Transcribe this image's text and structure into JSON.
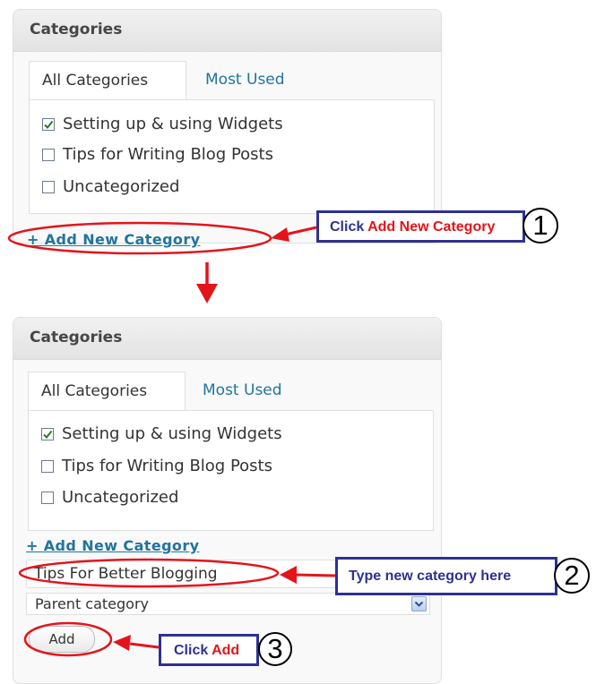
{
  "panel1": {
    "title": "Categories",
    "tabs": [
      {
        "label": "All Categories"
      },
      {
        "label": "Most Used"
      }
    ],
    "categories": [
      {
        "label": "Setting up & using Widgets",
        "checked": true
      },
      {
        "label": "Tips for Writing Blog Posts",
        "checked": false
      },
      {
        "label": "Uncategorized",
        "checked": false
      }
    ],
    "add_link": "+ Add New Category"
  },
  "panel2": {
    "title": "Categories",
    "tabs": [
      {
        "label": "All Categories"
      },
      {
        "label": "Most Used"
      }
    ],
    "categories": [
      {
        "label": "Setting up & using Widgets",
        "checked": true
      },
      {
        "label": "Tips for Writing Blog Posts",
        "checked": false
      },
      {
        "label": "Uncategorized",
        "checked": false
      }
    ],
    "add_link": "+ Add New Category",
    "new_category_value": "Tips For Better Blogging",
    "parent_select": "Parent category",
    "add_button": "Add"
  },
  "callouts": [
    {
      "prefix": "Click ",
      "highlight": "Add New Category",
      "number": "1"
    },
    {
      "prefix": "Type new category here",
      "highlight": "",
      "number": "2"
    },
    {
      "prefix": "Click ",
      "highlight": "Add",
      "number": "3"
    }
  ],
  "colors": {
    "accent_blue": "#2e3192",
    "annotation_red": "#e4141b",
    "link": "#21759b"
  }
}
